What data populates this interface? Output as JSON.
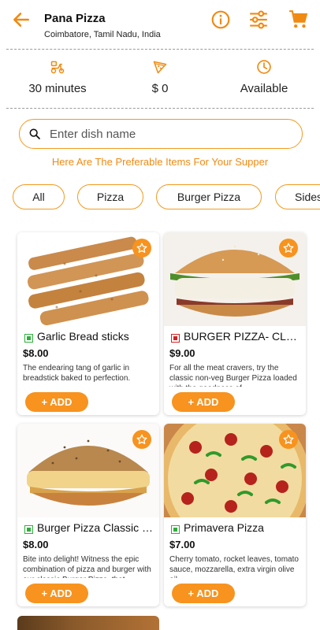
{
  "header": {
    "title": "Pana Pizza",
    "location": "Coimbatore, Tamil Nadu, India"
  },
  "stats": [
    {
      "icon": "delivery-scooter-icon",
      "value": "30 minutes"
    },
    {
      "icon": "pizza-slice-icon",
      "value": "$ 0"
    },
    {
      "icon": "clock-icon",
      "value": "Available"
    }
  ],
  "search": {
    "placeholder": "Enter dish name"
  },
  "tagline": "Here Are The Preferable Items For Your Supper",
  "categories": [
    "All",
    "Pizza",
    "Burger Pizza",
    "Sides"
  ],
  "products": [
    {
      "name": "Garlic Bread sticks",
      "type": "veg",
      "price": "$8.00",
      "description": "The endearing tang of garlic in breadstick baked to perfection.",
      "add_label": "+ ADD"
    },
    {
      "name": "BURGER PIZZA- CLASSIC NON VEG",
      "type": "nonveg",
      "price": "$9.00",
      "description": "For all the meat cravers, try the classic non-veg Burger Pizza loaded with the goodness of",
      "add_label": "+ ADD"
    },
    {
      "name": "Burger Pizza Classic Veg",
      "type": "veg",
      "price": "$8.00",
      "description": "Bite into delight! Witness the epic combination of pizza and burger with our classic Burger Pizza, that",
      "add_label": "+ ADD"
    },
    {
      "name": "Primavera Pizza",
      "type": "veg",
      "price": "$7.00",
      "description": "Cherry tomato, rocket leaves, tomato sauce, mozzarella, extra virgin olive oil.",
      "add_label": "+ ADD"
    }
  ],
  "colors": {
    "accent": "#f7931e",
    "veg": "#2fae3c",
    "nonveg": "#d32121"
  }
}
